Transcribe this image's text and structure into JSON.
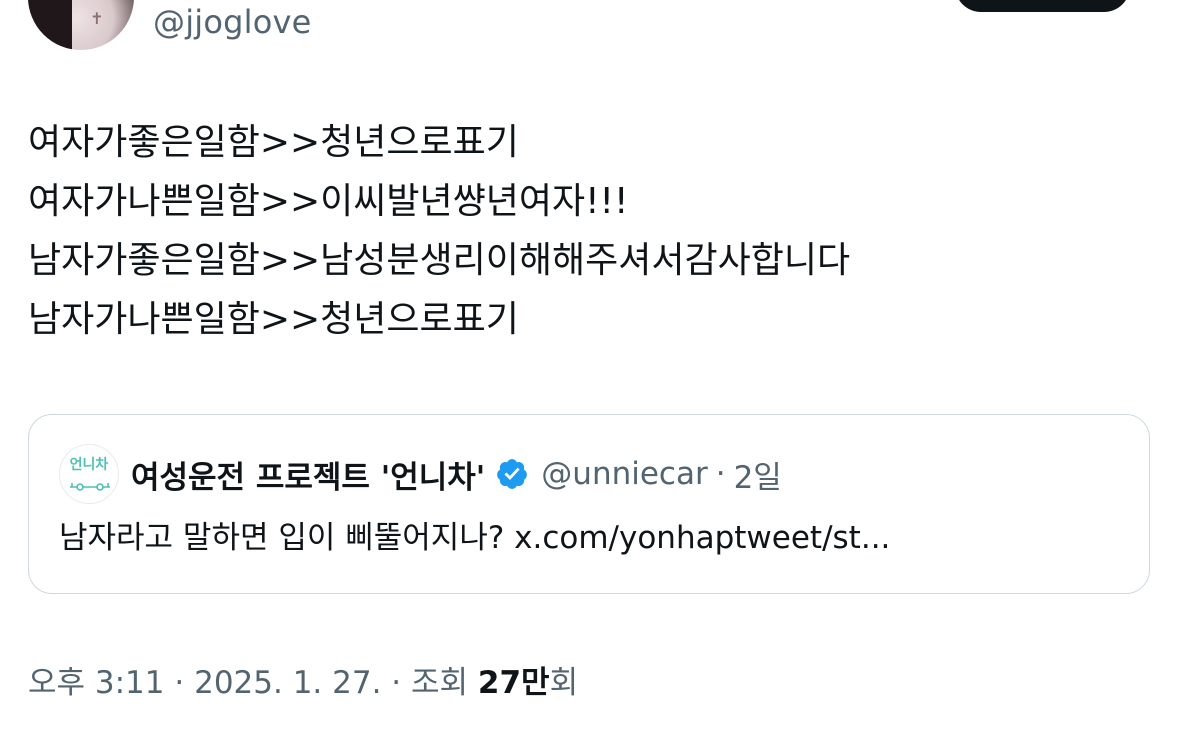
{
  "author": {
    "handle": "@jjoglove"
  },
  "tweet": {
    "lines": [
      "여자가좋은일함>>청년으로표기",
      "여자가나쁜일함>>이씨발년썅년여자!!!",
      "남자가좋은일함>>남성분생리이해해주셔서감사합니다",
      "남자가나쁜일함>>청년으로표기"
    ]
  },
  "quote": {
    "avatar_text": "언니차",
    "name": "여성운전 프로젝트 '언니차'",
    "handle": "@unniecar",
    "separator": "·",
    "time": "2일",
    "text": "남자라고 말하면 입이 삐뚤어지나? x.com/yonhaptweet/st...",
    "verified_icon": "verified-badge-icon",
    "verified_color": "#1d9bf0",
    "logo_color": "#4dc2b3"
  },
  "meta": {
    "time": "오후 3:11",
    "date": "2025. 1. 27.",
    "separator": "·",
    "views_label": "조회",
    "views_count": "27만",
    "views_suffix": "회"
  },
  "colors": {
    "text_primary": "#0f1419",
    "text_secondary": "#536471",
    "border": "#cfd9de",
    "button": "#0f1419"
  }
}
